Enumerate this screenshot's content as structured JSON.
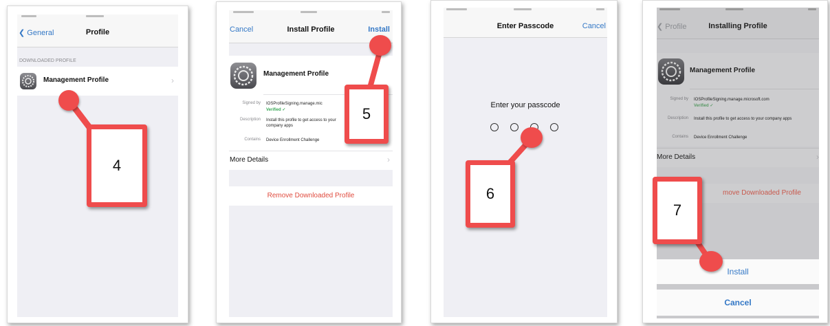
{
  "panel1": {
    "nav": {
      "back_label": "General",
      "title": "Profile"
    },
    "section_header": "DOWNLOADED PROFILE",
    "profile_name": "Management Profile",
    "step": "4"
  },
  "panel2": {
    "nav": {
      "cancel_label": "Cancel",
      "title": "Install Profile",
      "install_label": "Install"
    },
    "profile_name": "Management Profile",
    "details": {
      "signed_by_label": "Signed by",
      "signed_by_value": "IOSProfileSigning.manage.mic",
      "verified_label": "Verified",
      "description_label": "Description",
      "description_value": "Install this profile to get access to your company apps",
      "contains_label": "Contains",
      "contains_value": "Device Enrollment Challenge"
    },
    "more_details": "More Details",
    "remove_label": "Remove Downloaded Profile",
    "step": "5"
  },
  "panel3": {
    "nav": {
      "title": "Enter Passcode",
      "cancel_label": "Cancel"
    },
    "prompt": "Enter your passcode",
    "step": "6"
  },
  "panel4": {
    "nav": {
      "back_label": "Profile",
      "title": "Installing Profile"
    },
    "profile_name": "Management Profile",
    "details": {
      "signed_by_label": "Signed by",
      "signed_by_value": "IOSProfileSigning.manage.microsoft.com",
      "verified_label": "Verified",
      "description_label": "Description",
      "description_value": "Install this profile to get access to your company apps",
      "contains_label": "Contains",
      "contains_value": "Device Enrollment Challenge"
    },
    "more_details": "More Details",
    "remove_label": "move Downloaded Profile",
    "install_label": "Install",
    "cancel_label": "Cancel",
    "step": "7"
  },
  "colors": {
    "accent": "#3478c6",
    "annotation": "#ef4c4c",
    "destructive": "#e04b3e",
    "verified": "#3aa857"
  },
  "icons": [
    "settings-gear-icon",
    "chevron-left-icon",
    "chevron-right-icon",
    "checkmark-icon"
  ]
}
